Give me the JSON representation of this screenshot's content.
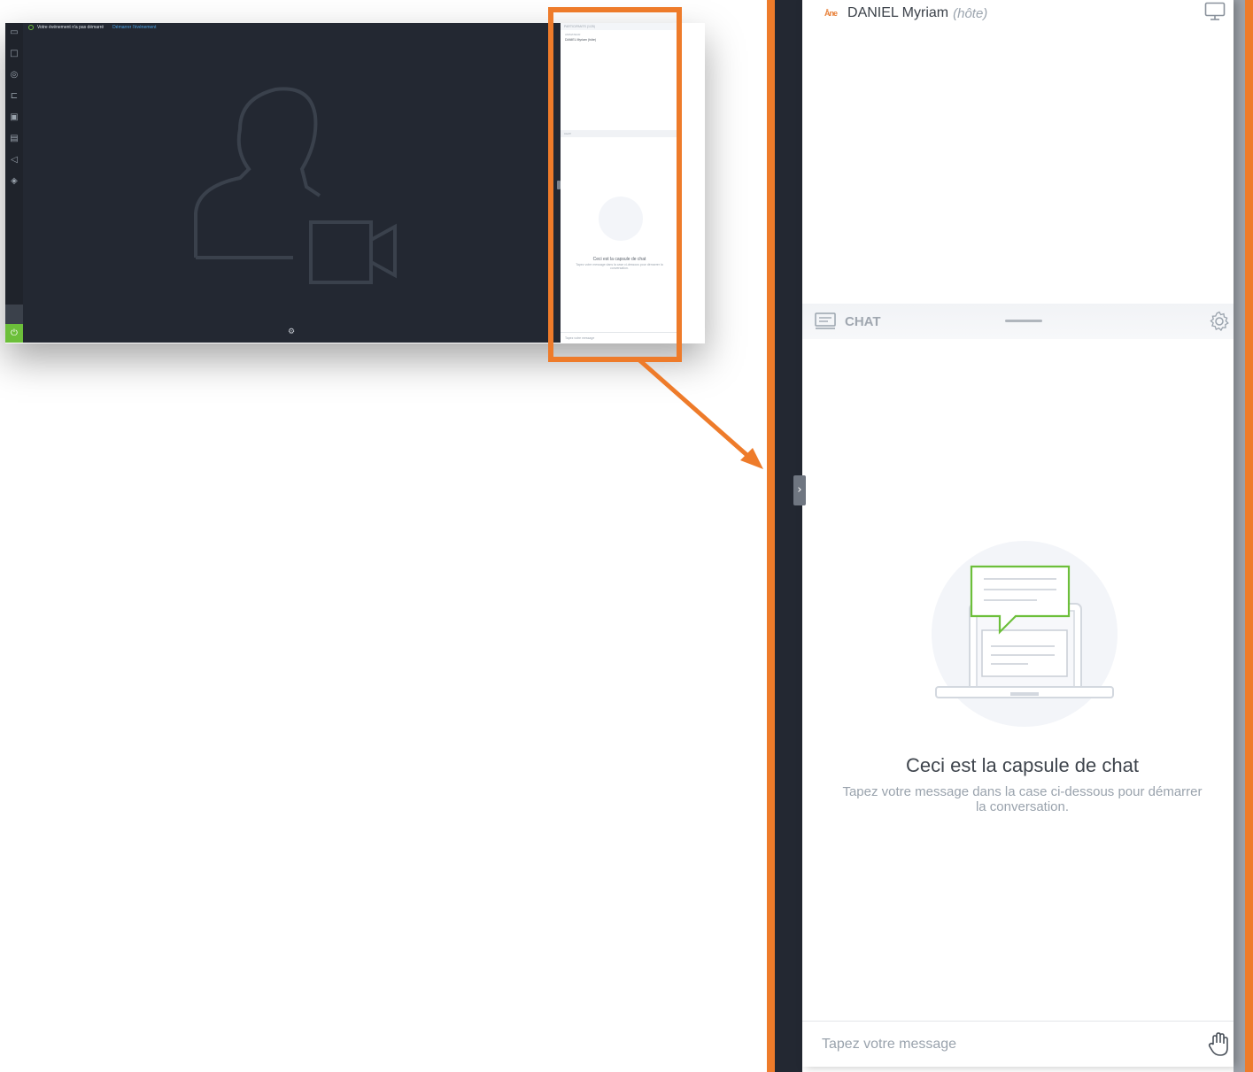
{
  "app": {
    "status_text": "Votre événement n'a pas démarré",
    "status_link": "Démarrer l'événement",
    "left_rail_icons": [
      "camera-icon",
      "screen-share-icon",
      "compass-icon",
      "whiteboard-icon",
      "media-icon",
      "files-icon",
      "megaphone-icon",
      "badge-icon"
    ],
    "support_icon": "headset-icon",
    "power_icon": "power-icon"
  },
  "mini_panel": {
    "participants_header": "PARTICIPANTS (1/25)",
    "section_label": "ANIMATEUR",
    "user": "DANIEL Myriam (hôte)",
    "chat_header": "CHAT",
    "empty_title": "Ceci est la capsule de chat",
    "empty_subtitle": "Tapez votre message dans la case ci-dessous pour démarrer la conversation.",
    "input_placeholder": "Tapez votre message"
  },
  "zoom": {
    "host_badge": "Åne",
    "host_name": "DANIEL Myriam",
    "host_role": "(hôte)",
    "chat_label": "CHAT",
    "empty_title": "Ceci est la capsule de chat",
    "empty_subtitle": "Tapez votre message dans la case ci-dessous pour démarrer la conversation.",
    "input_placeholder": "Tapez votre message",
    "collapse_glyph": "›"
  },
  "colors": {
    "highlight": "#ee7b2a",
    "dark_bg": "#232832",
    "accent_green": "#6cbf3a"
  }
}
